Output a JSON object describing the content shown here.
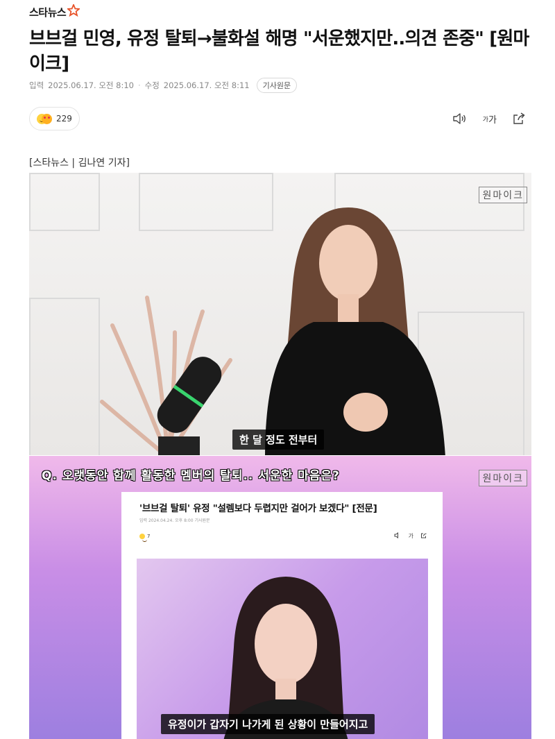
{
  "site": {
    "logo_text": "스타뉴스",
    "logo_star_icon": "star-icon"
  },
  "article": {
    "headline": "브브걸 민영, 유정 탈퇴→불화설 해명 \"서운했지만..의견 존중\" [원마이크]",
    "published_label": "입력",
    "published": "2025.06.17. 오전 8:10",
    "modified_label": "수정",
    "modified": "2025.06.17. 오전 8:11",
    "original_button": "기사원문",
    "reaction_count": "229",
    "font_size_label": "가",
    "byline": "[스타뉴스 | 김나연 기자]"
  },
  "icons": {
    "speaker": "speaker-icon",
    "font_size": "font-size-icon",
    "share": "share-icon"
  },
  "photo1": {
    "watermark": "원마이크",
    "caption": "한 달 정도 전부터"
  },
  "photo2": {
    "watermark": "원마이크",
    "question": "Q. 오랫동안 함께 활동한 멤버의 탈퇴.. 서운한 마음은?",
    "inner_headline": "'브브걸 탈퇴' 유정 \"설렘보다 두렵지만 걸어가 보겠다\" [전문]",
    "inner_meta": "입력 2024.04.24. 오후 8:00   기사원문",
    "inner_reaction_count": "7",
    "inner_font_size_label": "가",
    "caption": "유정이가 갑자기 나가게 된 상황이 만들어지고"
  },
  "colors": {
    "accent_star": "#e8542b",
    "caption_bg": "#000000",
    "pink_bg": "#d7a3ea"
  }
}
